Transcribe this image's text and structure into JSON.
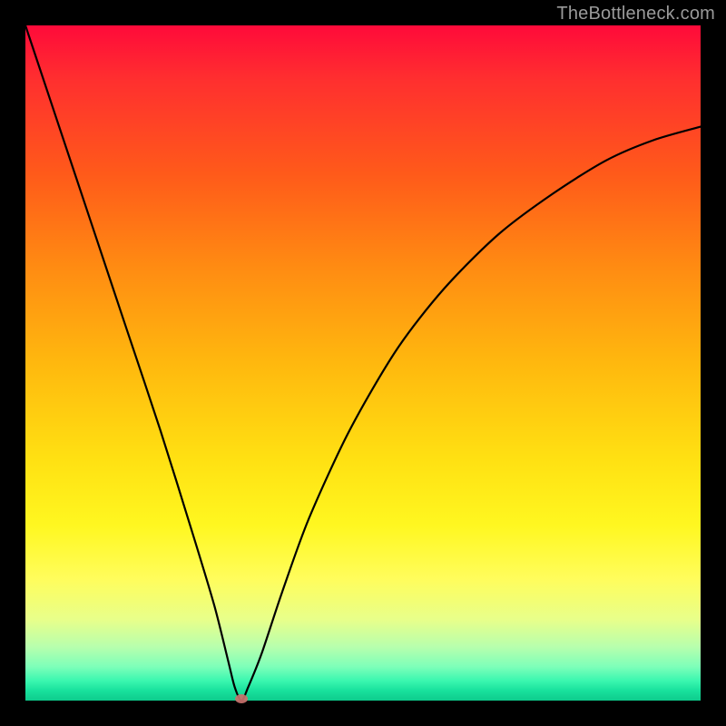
{
  "watermark": "TheBottleneck.com",
  "colors": {
    "frame": "#000000",
    "curve": "#000000",
    "marker": "#c9716c",
    "gradient_top": "#ff0a3a",
    "gradient_bottom": "#0ecb8c"
  },
  "chart_data": {
    "type": "line",
    "title": "",
    "xlabel": "",
    "ylabel": "",
    "xlim": [
      0,
      100
    ],
    "ylim": [
      0,
      100
    ],
    "grid": false,
    "legend": false,
    "description": "Bottleneck percentage curve: V-shaped minimum near the optimal match point with asymmetric rise on either side.",
    "minimum_point": {
      "x": 32,
      "y": 0
    },
    "series": [
      {
        "name": "bottleneck_pct",
        "x": [
          0,
          5,
          10,
          15,
          20,
          25,
          28,
          30,
          31,
          32,
          33,
          35,
          38,
          42,
          48,
          55,
          62,
          70,
          78,
          86,
          93,
          100
        ],
        "values": [
          100,
          85,
          70,
          55,
          40,
          24,
          14,
          6,
          2,
          0,
          2,
          7,
          16,
          27,
          40,
          52,
          61,
          69,
          75,
          80,
          83,
          85
        ]
      }
    ]
  }
}
